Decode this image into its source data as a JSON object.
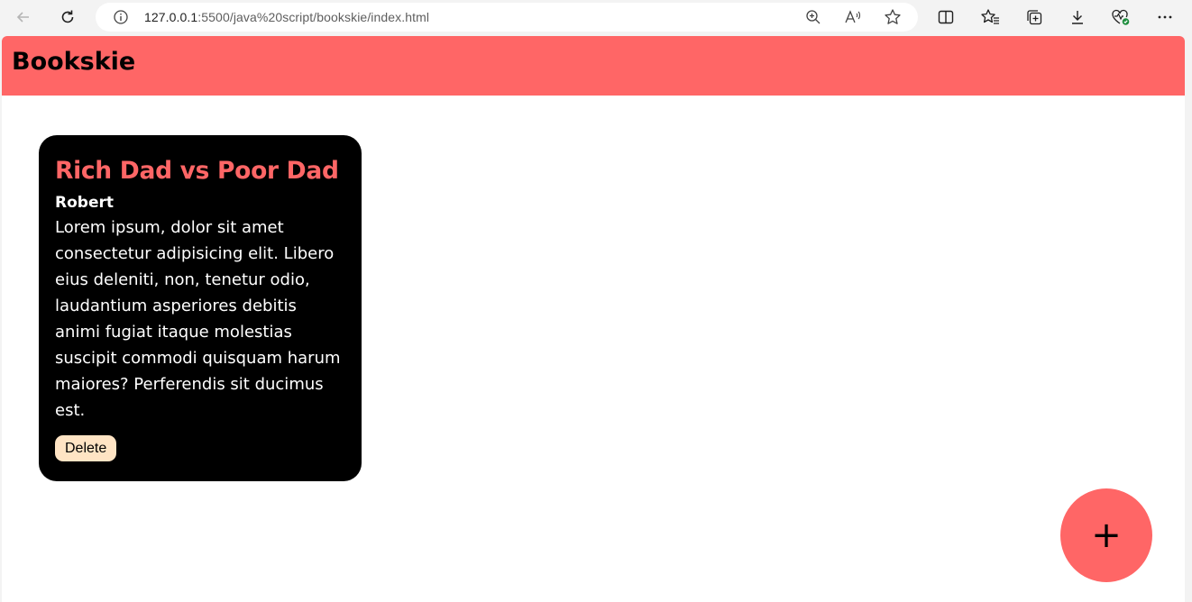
{
  "browser": {
    "url_host": "127.0.0.1",
    "url_rest": ":5500/java%20script/bookskie/index.html",
    "icons": [
      "back-icon",
      "refresh-icon",
      "info-icon",
      "zoom-icon",
      "read-aloud-icon",
      "favorite-star-icon",
      "split-screen-icon",
      "favorites-icon",
      "collections-icon",
      "downloads-icon",
      "performance-icon",
      "more-icon"
    ]
  },
  "header": {
    "title": "Bookskie",
    "color": "#ff6666"
  },
  "books": [
    {
      "title": "Rich Dad vs Poor Dad",
      "author": "Robert",
      "description": "Lorem ipsum, dolor sit amet consectetur adipisicing elit. Libero eius deleniti, non, tenetur odio, laudantium asperiores debitis animi fugiat itaque molestias suscipit commodi quisquam harum maiores? Perferendis sit ducimus est.",
      "delete_label": "Delete"
    }
  ],
  "add_button": {
    "label": "+"
  }
}
